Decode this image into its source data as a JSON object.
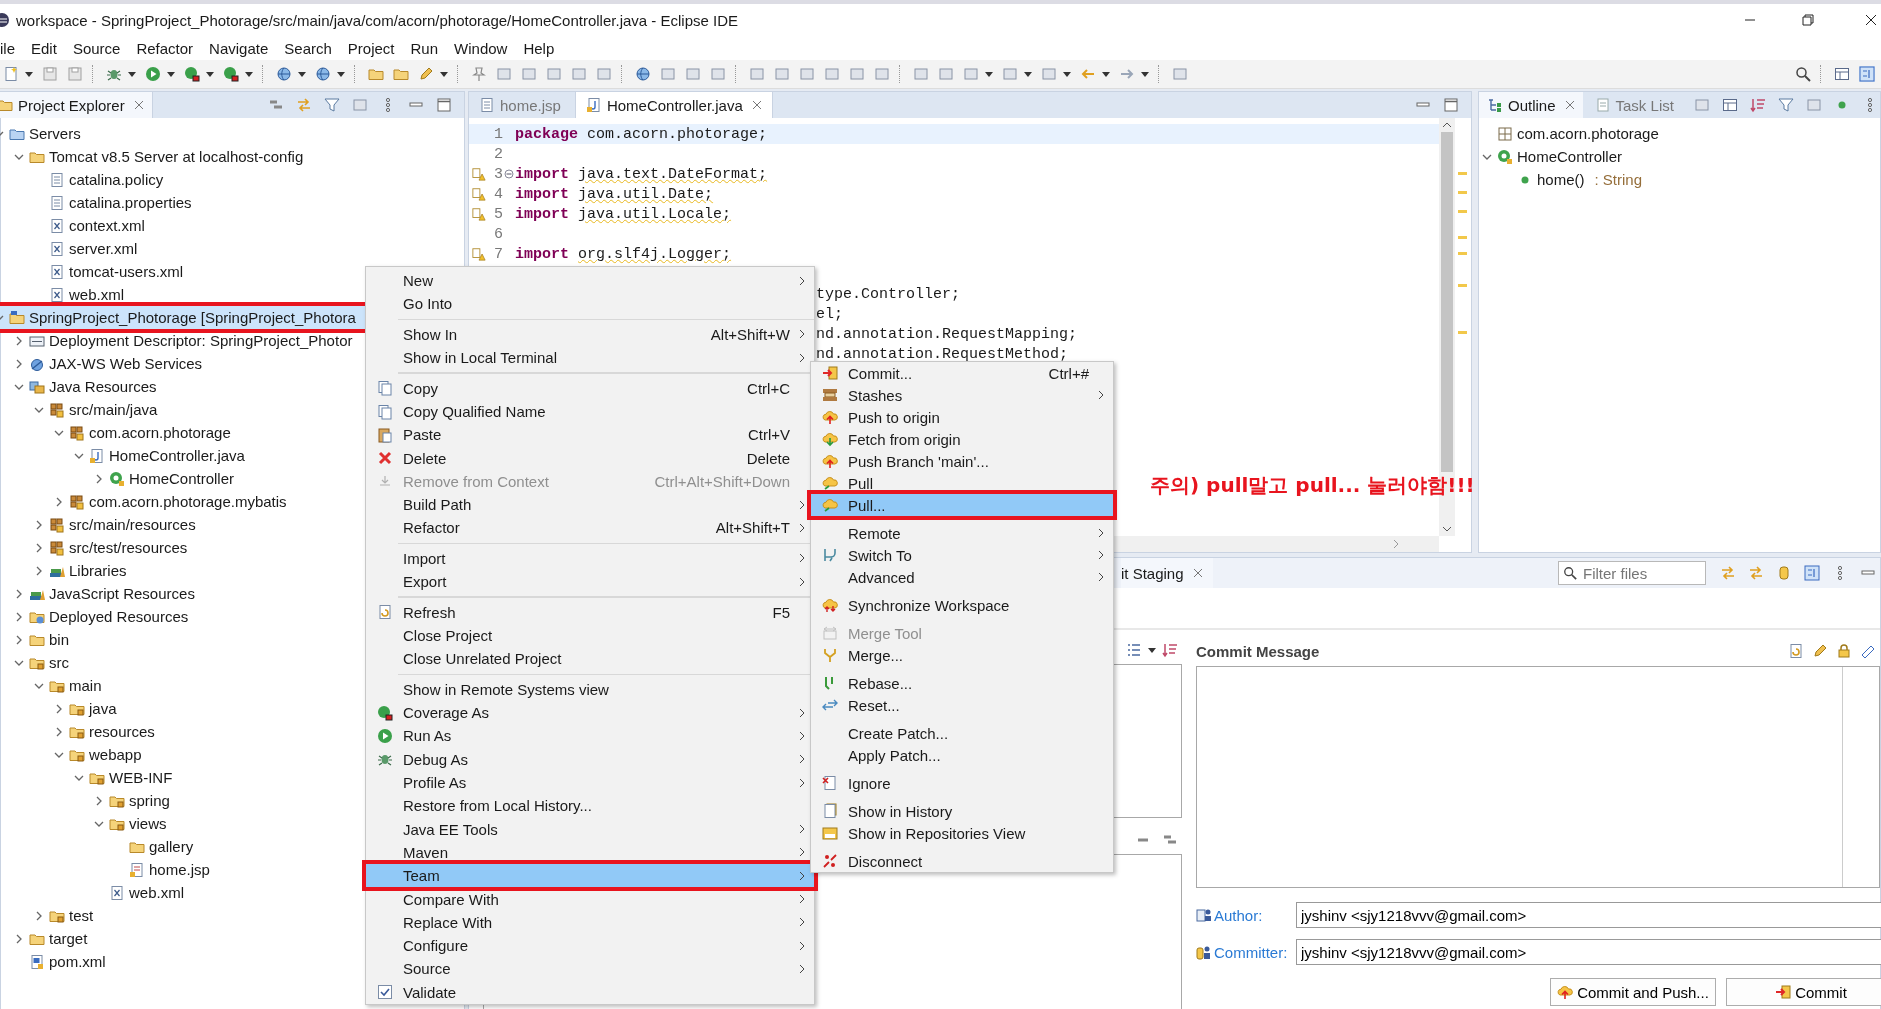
{
  "window": {
    "title": "workspace - SpringProject_Photorage/src/main/java/com/acorn/photorage/HomeController.java - Eclipse IDE"
  },
  "menu_bar": [
    "ile",
    "Edit",
    "Source",
    "Refactor",
    "Navigate",
    "Search",
    "Project",
    "Run",
    "Window",
    "Help"
  ],
  "project_explorer": {
    "title": "Project Explorer",
    "tree": [
      {
        "label": "Servers",
        "kind": "server-folder",
        "selected": false,
        "expanded": true,
        "children": [
          {
            "label": "Tomcat v8.5 Server at localhost-config",
            "kind": "folder",
            "selected": false,
            "expanded": true,
            "children": [
              {
                "label": "catalina.policy",
                "kind": "file",
                "selected": false
              },
              {
                "label": "catalina.properties",
                "kind": "file",
                "selected": false
              },
              {
                "label": "context.xml",
                "kind": "xml",
                "selected": false
              },
              {
                "label": "server.xml",
                "kind": "xml",
                "selected": false
              },
              {
                "label": "tomcat-users.xml",
                "kind": "xml",
                "selected": false
              },
              {
                "label": "web.xml",
                "kind": "xml",
                "selected": false
              }
            ]
          }
        ]
      },
      {
        "label": "SpringProject_Photorage [SpringProject_Photora",
        "kind": "project",
        "selected": true,
        "framed": true,
        "expanded": true,
        "children": [
          {
            "label": "Deployment Descriptor: SpringProject_Photor",
            "kind": "descriptor",
            "selected": false,
            "expanded": false
          },
          {
            "label": "JAX-WS Web Services",
            "kind": "webservice",
            "selected": false,
            "expanded": false
          },
          {
            "label": "Java Resources",
            "kind": "resources",
            "selected": false,
            "expanded": true,
            "children": [
              {
                "label": "src/main/java",
                "kind": "package",
                "selected": false,
                "expanded": true,
                "children": [
                  {
                    "label": "com.acorn.photorage",
                    "kind": "package",
                    "selected": false,
                    "expanded": true,
                    "children": [
                      {
                        "label": "HomeController.java",
                        "kind": "java-file",
                        "selected": false,
                        "expanded": true,
                        "children": [
                          {
                            "label": "HomeController",
                            "kind": "class",
                            "selected": false,
                            "expanded": false
                          }
                        ]
                      }
                    ]
                  },
                  {
                    "label": "com.acorn.photorage.mybatis",
                    "kind": "package",
                    "selected": false,
                    "expanded": false
                  }
                ]
              },
              {
                "label": "src/main/resources",
                "kind": "package",
                "selected": false,
                "expanded": false
              },
              {
                "label": "src/test/resources",
                "kind": "package",
                "selected": false,
                "expanded": false
              },
              {
                "label": "Libraries",
                "kind": "library",
                "selected": false,
                "expanded": false
              }
            ]
          },
          {
            "label": "JavaScript Resources",
            "kind": "library",
            "selected": false,
            "expanded": false
          },
          {
            "label": "Deployed Resources",
            "kind": "deployed",
            "selected": false,
            "expanded": false
          },
          {
            "label": "bin",
            "kind": "folder",
            "selected": false,
            "expanded": false
          },
          {
            "label": "src",
            "kind": "source-folder",
            "selected": false,
            "expanded": true,
            "children": [
              {
                "label": "main",
                "kind": "source-folder",
                "selected": false,
                "expanded": true,
                "children": [
                  {
                    "label": "java",
                    "kind": "source-folder",
                    "selected": false,
                    "expanded": false
                  },
                  {
                    "label": "resources",
                    "kind": "source-folder",
                    "selected": false,
                    "expanded": false
                  },
                  {
                    "label": "webapp",
                    "kind": "source-folder",
                    "selected": false,
                    "expanded": true,
                    "children": [
                      {
                        "label": "WEB-INF",
                        "kind": "source-folder",
                        "selected": false,
                        "expanded": true,
                        "children": [
                          {
                            "label": "spring",
                            "kind": "source-folder",
                            "selected": false,
                            "expanded": false
                          },
                          {
                            "label": "views",
                            "kind": "source-folder",
                            "selected": false,
                            "expanded": true,
                            "children": [
                              {
                                "label": "gallery",
                                "kind": "folder",
                                "selected": false
                              },
                              {
                                "label": "home.jsp",
                                "kind": "jsp",
                                "selected": false
                              }
                            ]
                          },
                          {
                            "label": "web.xml",
                            "kind": "xml",
                            "selected": false
                          }
                        ]
                      }
                    ]
                  }
                ]
              },
              {
                "label": "test",
                "kind": "source-folder",
                "selected": false,
                "expanded": false
              }
            ]
          },
          {
            "label": "target",
            "kind": "folder",
            "selected": false,
            "expanded": false
          },
          {
            "label": "pom.xml",
            "kind": "pom",
            "selected": false
          }
        ]
      }
    ]
  },
  "editor": {
    "tabs": [
      {
        "label": "home.jsp",
        "selected": false
      },
      {
        "label": "HomeController.java",
        "selected": true
      }
    ],
    "lines": [
      {
        "number": "1",
        "keyword": "package",
        "text": "com.acorn.photorage;",
        "current": true,
        "warning": false,
        "fold": false
      },
      {
        "number": "2",
        "current": false,
        "warning": false,
        "fold": false
      },
      {
        "number": "3",
        "keyword": "import",
        "text": "java.text.DateFormat;",
        "current": false,
        "warning": true,
        "fold": true
      },
      {
        "number": "4",
        "keyword": "import",
        "text": "java.util.Date;",
        "current": false,
        "warning": true,
        "fold": false
      },
      {
        "number": "5",
        "keyword": "import",
        "text": "java.util.Locale;",
        "current": false,
        "warning": true,
        "fold": false
      },
      {
        "number": "6",
        "current": false,
        "warning": false,
        "fold": false
      },
      {
        "number": "7",
        "keyword": "import",
        "text": "org.slf4j.Logger;",
        "current": false,
        "warning": true,
        "fold": false
      }
    ],
    "covered_lines": [
      {
        "text": "type.Controller;"
      },
      {
        "text": "el;"
      },
      {
        "text": "nd.annotation.RequestMapping;"
      },
      {
        "text": "nd.annotation.RequestMethod;"
      }
    ]
  },
  "outline": {
    "tabs": [
      {
        "label": "Outline",
        "selected": true
      },
      {
        "label": "Task List",
        "selected": false
      }
    ],
    "tree": [
      {
        "label": "com.acorn.photorage",
        "kind": "package-decl"
      },
      {
        "label": "HomeController",
        "kind": "class",
        "expanded": true,
        "children": [
          {
            "label": "home()",
            "type": ": String",
            "kind": "method"
          }
        ]
      }
    ]
  },
  "git_staging": {
    "tab": "it Staging",
    "filter": {
      "placeholder": "Filter files"
    },
    "commit_message": {
      "label": "Commit Message"
    },
    "author": {
      "label": "Author:",
      "value": "jyshinv <sjy1218vvv@gmail.com>"
    },
    "committer": {
      "label": "Committer:",
      "value": "jyshinv <sjy1218vvv@gmail.com>"
    },
    "buttons": [
      "Commit and Push...",
      "Commit"
    ]
  },
  "context_menu": {
    "items": [
      {
        "kind": "item",
        "label": "New",
        "submenu": true,
        "disabled": false,
        "selected": false
      },
      {
        "kind": "item",
        "label": "Go Into",
        "submenu": false,
        "disabled": false,
        "selected": false
      },
      {
        "kind": "separator"
      },
      {
        "kind": "item",
        "label": "Show In",
        "shortcut": "Alt+Shift+W",
        "submenu": true,
        "disabled": false,
        "selected": false
      },
      {
        "kind": "item",
        "label": "Show in Local Terminal",
        "submenu": true,
        "disabled": false,
        "selected": false
      },
      {
        "kind": "separator"
      },
      {
        "kind": "item",
        "label": "Copy",
        "shortcut": "Ctrl+C",
        "submenu": false,
        "disabled": false,
        "selected": false
      },
      {
        "kind": "item",
        "label": "Copy Qualified Name",
        "submenu": false,
        "disabled": false,
        "selected": false
      },
      {
        "kind": "item",
        "label": "Paste",
        "shortcut": "Ctrl+V",
        "submenu": false,
        "disabled": false,
        "selected": false
      },
      {
        "kind": "item",
        "label": "Delete",
        "shortcut": "Delete",
        "submenu": false,
        "disabled": false,
        "selected": false
      },
      {
        "kind": "item",
        "label": "Remove from Context",
        "shortcut": "Ctrl+Alt+Shift+Down",
        "submenu": false,
        "disabled": true,
        "selected": false
      },
      {
        "kind": "item",
        "label": "Build Path",
        "submenu": true,
        "disabled": false,
        "selected": false
      },
      {
        "kind": "item",
        "label": "Refactor",
        "shortcut": "Alt+Shift+T",
        "submenu": true,
        "disabled": false,
        "selected": false
      },
      {
        "kind": "separator"
      },
      {
        "kind": "item",
        "label": "Import",
        "submenu": true,
        "disabled": false,
        "selected": false
      },
      {
        "kind": "item",
        "label": "Export",
        "submenu": true,
        "disabled": false,
        "selected": false
      },
      {
        "kind": "separator"
      },
      {
        "kind": "item",
        "label": "Refresh",
        "shortcut": "F5",
        "submenu": false,
        "disabled": false,
        "selected": false
      },
      {
        "kind": "item",
        "label": "Close Project",
        "submenu": false,
        "disabled": false,
        "selected": false
      },
      {
        "kind": "item",
        "label": "Close Unrelated Project",
        "submenu": false,
        "disabled": false,
        "selected": false
      },
      {
        "kind": "separator"
      },
      {
        "kind": "item",
        "label": "Show in Remote Systems view",
        "submenu": false,
        "disabled": false,
        "selected": false
      },
      {
        "kind": "item",
        "label": "Coverage As",
        "submenu": true,
        "disabled": false,
        "selected": false
      },
      {
        "kind": "item",
        "label": "Run As",
        "submenu": true,
        "disabled": false,
        "selected": false
      },
      {
        "kind": "item",
        "label": "Debug As",
        "submenu": true,
        "disabled": false,
        "selected": false
      },
      {
        "kind": "item",
        "label": "Profile As",
        "submenu": true,
        "disabled": false,
        "selected": false
      },
      {
        "kind": "item",
        "label": "Restore from Local History...",
        "submenu": false,
        "disabled": false,
        "selected": false
      },
      {
        "kind": "item",
        "label": "Java EE Tools",
        "submenu": true,
        "disabled": false,
        "selected": false
      },
      {
        "kind": "item",
        "label": "Maven",
        "submenu": true,
        "disabled": false,
        "selected": false
      },
      {
        "kind": "item",
        "label": "Team",
        "submenu": true,
        "disabled": false,
        "selected": true,
        "framed": true
      },
      {
        "kind": "item",
        "label": "Compare With",
        "submenu": true,
        "disabled": false,
        "selected": false
      },
      {
        "kind": "item",
        "label": "Replace With",
        "submenu": true,
        "disabled": false,
        "selected": false
      },
      {
        "kind": "item",
        "label": "Configure",
        "submenu": true,
        "disabled": false,
        "selected": false
      },
      {
        "kind": "item",
        "label": "Source",
        "submenu": true,
        "disabled": false,
        "selected": false
      },
      {
        "kind": "item",
        "label": "Validate",
        "submenu": false,
        "disabled": false,
        "selected": false
      }
    ]
  },
  "team_submenu": {
    "items": [
      {
        "kind": "item",
        "label": "Commit...",
        "shortcut": "Ctrl+#",
        "submenu": false,
        "disabled": false,
        "selected": false
      },
      {
        "kind": "item",
        "label": "Stashes",
        "submenu": true,
        "disabled": false,
        "selected": false
      },
      {
        "kind": "item",
        "label": "Push to origin",
        "submenu": false,
        "disabled": false,
        "selected": false
      },
      {
        "kind": "item",
        "label": "Fetch from origin",
        "submenu": false,
        "disabled": false,
        "selected": false
      },
      {
        "kind": "item",
        "label": "Push Branch 'main'...",
        "submenu": false,
        "disabled": false,
        "selected": false
      },
      {
        "kind": "item",
        "label": "Pull",
        "submenu": false,
        "disabled": false,
        "selected": false
      },
      {
        "kind": "item",
        "label": "Pull...",
        "submenu": false,
        "disabled": false,
        "selected": true,
        "framed": true
      },
      {
        "kind": "separator"
      },
      {
        "kind": "item",
        "label": "Remote",
        "submenu": true,
        "disabled": false,
        "selected": false
      },
      {
        "kind": "item",
        "label": "Switch To",
        "submenu": true,
        "disabled": false,
        "selected": false
      },
      {
        "kind": "item",
        "label": "Advanced",
        "submenu": true,
        "disabled": false,
        "selected": false
      },
      {
        "kind": "separator"
      },
      {
        "kind": "item",
        "label": "Synchronize Workspace",
        "submenu": false,
        "disabled": false,
        "selected": false
      },
      {
        "kind": "separator"
      },
      {
        "kind": "item",
        "label": "Merge Tool",
        "submenu": false,
        "disabled": true,
        "selected": false
      },
      {
        "kind": "item",
        "label": "Merge...",
        "submenu": false,
        "disabled": false,
        "selected": false
      },
      {
        "kind": "separator"
      },
      {
        "kind": "item",
        "label": "Rebase...",
        "submenu": false,
        "disabled": false,
        "selected": false
      },
      {
        "kind": "item",
        "label": "Reset...",
        "submenu": false,
        "disabled": false,
        "selected": false
      },
      {
        "kind": "separator"
      },
      {
        "kind": "item",
        "label": "Create Patch...",
        "submenu": false,
        "disabled": false,
        "selected": false
      },
      {
        "kind": "item",
        "label": "Apply Patch...",
        "submenu": false,
        "disabled": false,
        "selected": false
      },
      {
        "kind": "separator"
      },
      {
        "kind": "item",
        "label": "Ignore",
        "submenu": false,
        "disabled": false,
        "selected": false
      },
      {
        "kind": "separator"
      },
      {
        "kind": "item",
        "label": "Show in History",
        "submenu": false,
        "disabled": false,
        "selected": false
      },
      {
        "kind": "item",
        "label": "Show in Repositories View",
        "submenu": false,
        "disabled": false,
        "selected": false
      },
      {
        "kind": "separator"
      },
      {
        "kind": "item",
        "label": "Disconnect",
        "submenu": false,
        "disabled": false,
        "selected": false
      }
    ]
  },
  "annotation": "주의) pull말고 pull... 눌러야함!!!"
}
